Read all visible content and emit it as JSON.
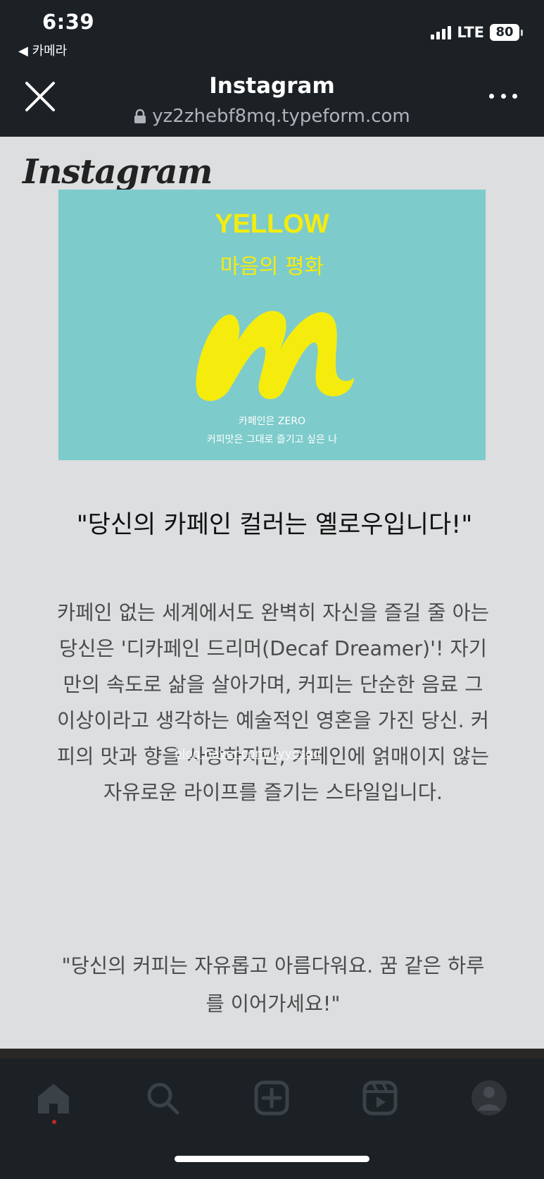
{
  "status_bar": {
    "time": "6:39",
    "back_app": "◀ 카메라",
    "network": "LTE",
    "battery": "80"
  },
  "browser": {
    "title": "Instagram",
    "url": "yz2zhebf8mq.typeform.com",
    "icons": [
      "close-icon",
      "lock-icon",
      "more-icon"
    ]
  },
  "page": {
    "wordmark": "Instagram",
    "card": {
      "title": "YELLOW",
      "subtitle": "마음의 평화",
      "line1": "카페인은 ZERO",
      "line2": "커피맛은 그대로 즐기고 싶은 나",
      "background": "#7ecbcb",
      "accent": "#f5ec0e"
    },
    "heading": "\"당신의 카페인 컬러는 옐로우입니다!\"",
    "body": "카페인 없는 세계에서도 완벽히 자신을 즐길 줄 아는 당신은 '디카페인 드리머(Decaf Dreamer)'! 자기만의 속도로 삶을 살아가며, 커피는 단순한 음료 그 이상이라고 생각하는 예술적인 영혼을 가진 당신. 커피의 맛과 향을 사랑하지만, 카페인에 얽매이지 않는 자유로운 라이프를 즐기는 스타일입니다.",
    "watermark": "blog.naver.com/yyyesoo",
    "closing": "\"당신의 커피는 자유롭고 아름다워요. 꿈 같은 하루를 이어가세요!\""
  },
  "bottom_nav": {
    "icons": [
      "home-icon",
      "search-icon",
      "create-icon",
      "reels-icon",
      "profile-avatar-icon"
    ],
    "active": "home"
  }
}
